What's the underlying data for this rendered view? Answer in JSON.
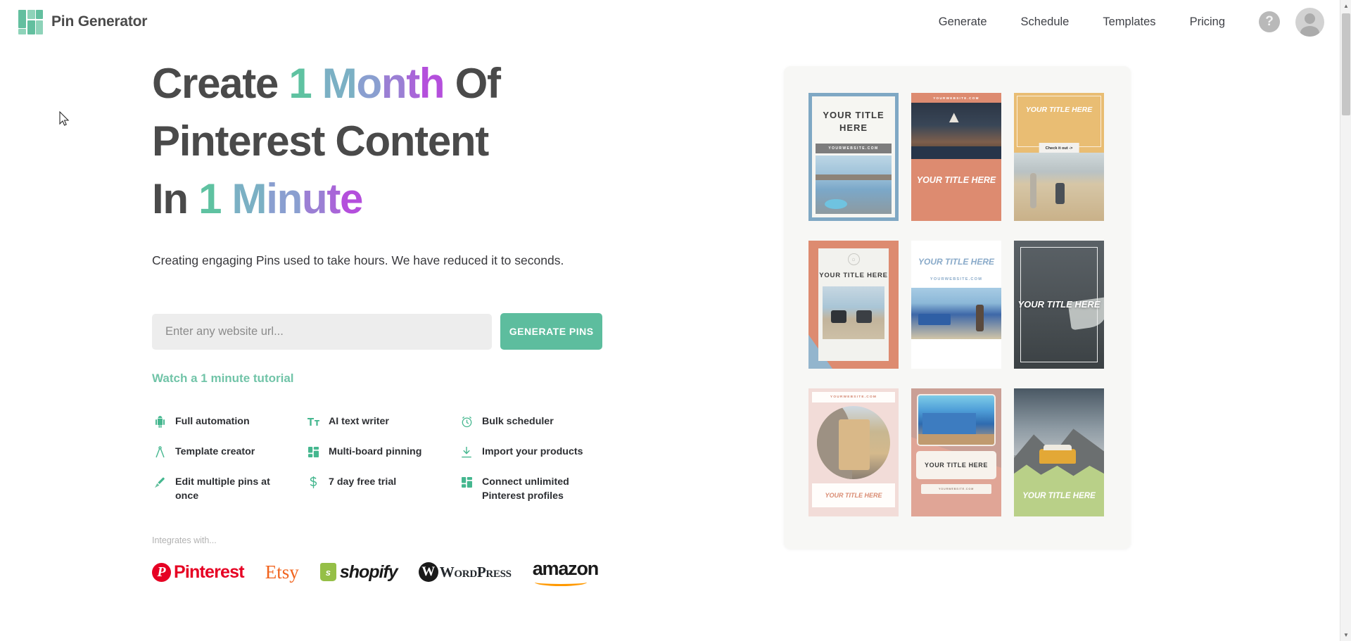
{
  "nav": {
    "brand": "Pin Generator",
    "logo_icon": "grid-logo-icon",
    "links": [
      {
        "label": "Generate"
      },
      {
        "label": "Schedule"
      },
      {
        "label": "Templates"
      },
      {
        "label": "Pricing"
      }
    ],
    "help_label": "?",
    "help_icon": "question-mark-icon",
    "avatar_icon": "user-avatar-icon"
  },
  "hero": {
    "headline": {
      "line1_a": "Create ",
      "line1_n": "1",
      "line1_m1": "M",
      "line1_m2": "o",
      "line1_m3": "n",
      "line1_m4": "t",
      "line1_m5": "h",
      "line1_b": " Of",
      "line2": "Pinterest Content",
      "line3_a": "In ",
      "line3_n": "1",
      "line3_m1": "M",
      "line3_m2": "i",
      "line3_m3": "n",
      "line3_m4": "u",
      "line3_m5": "t",
      "line3_m6": "e"
    },
    "subhead": "Creating engaging Pins used to take hours. We have reduced it to seconds.",
    "url_placeholder": "Enter any website url...",
    "url_value": "",
    "generate_button": "GENERATE PINS",
    "tutorial_link": "Watch a 1 minute tutorial",
    "accent_green": "#5dbd9e",
    "gradient_colors": [
      "#5fc2a1",
      "#7bb0c4",
      "#8a9fd0",
      "#9b7fd4",
      "#a866d8",
      "#b44fdc"
    ]
  },
  "features": [
    {
      "icon": "robot-icon",
      "label": "Full automation"
    },
    {
      "icon": "text-format-icon",
      "label": "AI text writer"
    },
    {
      "icon": "alarm-clock-icon",
      "label": "Bulk scheduler"
    },
    {
      "icon": "compass-icon",
      "label": "Template creator"
    },
    {
      "icon": "grid-icon",
      "label": "Multi-board pinning"
    },
    {
      "icon": "download-icon",
      "label": "Import your products"
    },
    {
      "icon": "brush-icon",
      "label": "Edit multiple pins at once"
    },
    {
      "icon": "dollar-icon",
      "label": "7 day free trial"
    },
    {
      "icon": "grid-icon",
      "label": "Connect unlimited Pinterest profiles"
    }
  ],
  "integrations": {
    "label": "Integrates with...",
    "brands": [
      {
        "name": "Pinterest",
        "icon": "pinterest-logo",
        "color": "#e60023"
      },
      {
        "name": "Etsy",
        "icon": "etsy-logo",
        "color": "#f1641e"
      },
      {
        "name": "shopify",
        "icon": "shopify-logo",
        "color": "#95bf47"
      },
      {
        "name": "WordPress",
        "icon": "wordpress-logo",
        "color": "#23282d"
      },
      {
        "name": "amazon",
        "icon": "amazon-logo",
        "color": "#ff9900"
      }
    ]
  },
  "pin_preview": {
    "pins": [
      {
        "id": 1,
        "title": "YOUR TITLE HERE",
        "website": "YOURWEBSITE.COM",
        "style": "blue-frame"
      },
      {
        "id": 2,
        "title": "YOUR TITLE HERE",
        "website": "YOURWEBSITE.COM",
        "style": "coral-bottom"
      },
      {
        "id": 3,
        "title": "YOUR TITLE HERE",
        "cta": "Check it out ->",
        "style": "tan-header"
      },
      {
        "id": 4,
        "title": "YOUR TITLE HERE",
        "style": "coral-card"
      },
      {
        "id": 5,
        "title": "YOUR TITLE HERE",
        "website": "YOURWEBSITE.COM",
        "style": "white-blue"
      },
      {
        "id": 6,
        "title": "YOUR TITLE HERE",
        "style": "dark-overlay"
      },
      {
        "id": 7,
        "title": "YOUR TITLE HERE",
        "website": "YOURWEBSITE.COM",
        "style": "pink-circle"
      },
      {
        "id": 8,
        "title": "YOUR TITLE HERE",
        "website": "YOURWEBSITE.COM",
        "style": "mauve-card"
      },
      {
        "id": 9,
        "title": "YOUR TITLE HERE",
        "style": "green-wave"
      }
    ]
  },
  "scrollbar": {
    "up": "▲",
    "down": "▼"
  }
}
